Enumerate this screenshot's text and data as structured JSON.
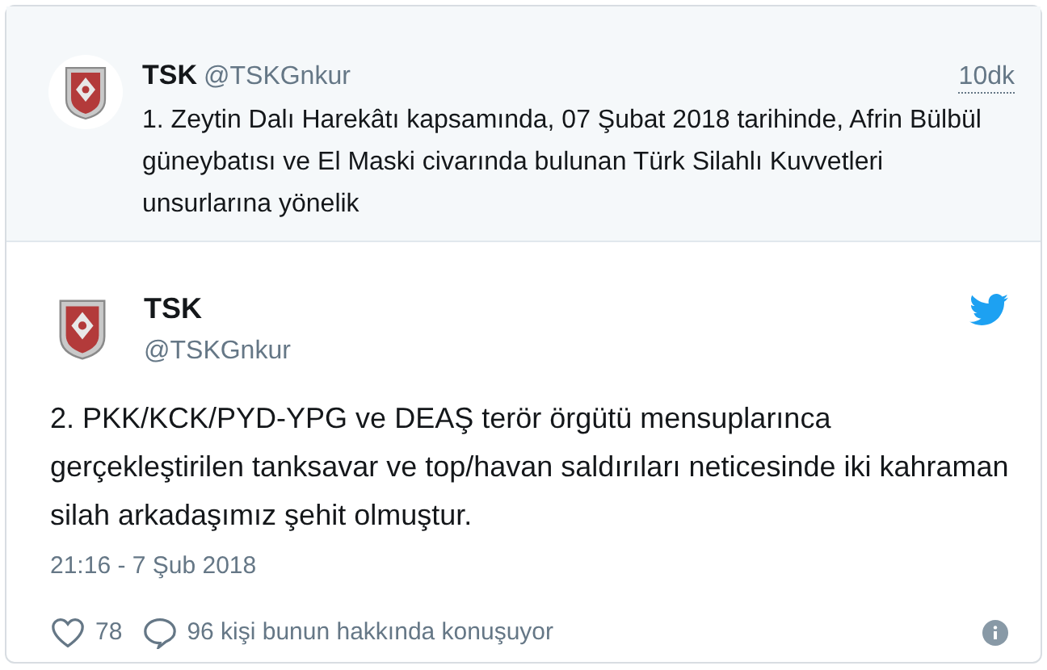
{
  "quoted_tweet": {
    "name": "TSK",
    "handle": "@TSKGnkur",
    "time": "10dk",
    "text": "1. Zeytin Dalı Harekâtı kapsamında, 07 Şubat 2018 tarihinde, Afrin Bülbül güneybatısı ve El Maski civarında bulunan Türk Silahlı Kuvvetleri unsurlarına yönelik"
  },
  "tweet": {
    "name": "TSK",
    "handle": "@TSKGnkur",
    "text": "2. PKK/KCK/PYD-YPG ve DEAŞ terör örgütü mensuplarınca gerçekleştirilen tanksavar ve top/havan saldırıları neticesinde iki kahraman silah arkadaşımız şehit olmuştur.",
    "timestamp": "21:16 - 7 Şub 2018",
    "likes": "78",
    "replies_text": "96 kişi bunun hakkında konuşuyor"
  }
}
